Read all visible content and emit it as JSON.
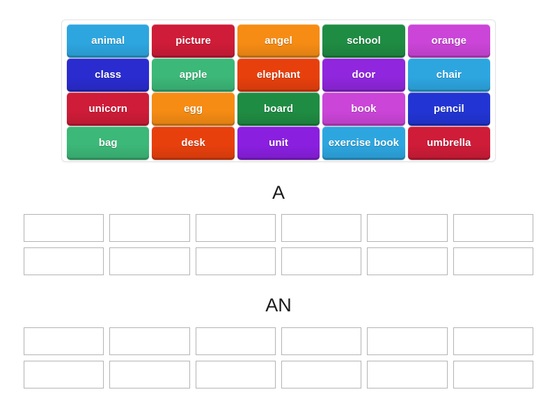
{
  "activity": {
    "type": "group-sort",
    "word_bank": {
      "rows": [
        [
          {
            "label": "animal",
            "color": "#2da6e0"
          },
          {
            "label": "picture",
            "color": "#cf1c38"
          },
          {
            "label": "angel",
            "color": "#f68c14"
          },
          {
            "label": "school",
            "color": "#1f8c43"
          },
          {
            "label": "orange",
            "color": "#cb45d8"
          }
        ],
        [
          {
            "label": "class",
            "color": "#2a2cd0"
          },
          {
            "label": "apple",
            "color": "#3cb878"
          },
          {
            "label": "elephant",
            "color": "#e8400d"
          },
          {
            "label": "door",
            "color": "#9026dd"
          },
          {
            "label": "chair",
            "color": "#2da6e0"
          }
        ],
        [
          {
            "label": "unicorn",
            "color": "#cf1c38"
          },
          {
            "label": "egg",
            "color": "#f68c14"
          },
          {
            "label": "board",
            "color": "#1f8c43"
          },
          {
            "label": "book",
            "color": "#cb45d8"
          },
          {
            "label": "pencil",
            "color": "#2235d4"
          }
        ],
        [
          {
            "label": "bag",
            "color": "#3cb878"
          },
          {
            "label": "desk",
            "color": "#e8400d"
          },
          {
            "label": "unit",
            "color": "#8a1fe0"
          },
          {
            "label": "exercise book",
            "color": "#2da6e0"
          },
          {
            "label": "umbrella",
            "color": "#cf1c38"
          }
        ]
      ]
    },
    "groups": [
      {
        "heading": "A",
        "slot_rows": [
          [
            "",
            "",
            "",
            "",
            "",
            ""
          ],
          [
            "",
            "",
            "",
            "",
            "",
            ""
          ]
        ]
      },
      {
        "heading": "AN",
        "slot_rows": [
          [
            "",
            "",
            "",
            "",
            "",
            ""
          ],
          [
            "",
            "",
            "",
            "",
            "",
            ""
          ]
        ]
      }
    ]
  },
  "colors": {
    "background": "#ffffff",
    "bank_border": "#e3e3e3",
    "dropzone_border": "#b3b3b3",
    "heading_text": "#1a1a1a",
    "tile_text": "#ffffff"
  }
}
